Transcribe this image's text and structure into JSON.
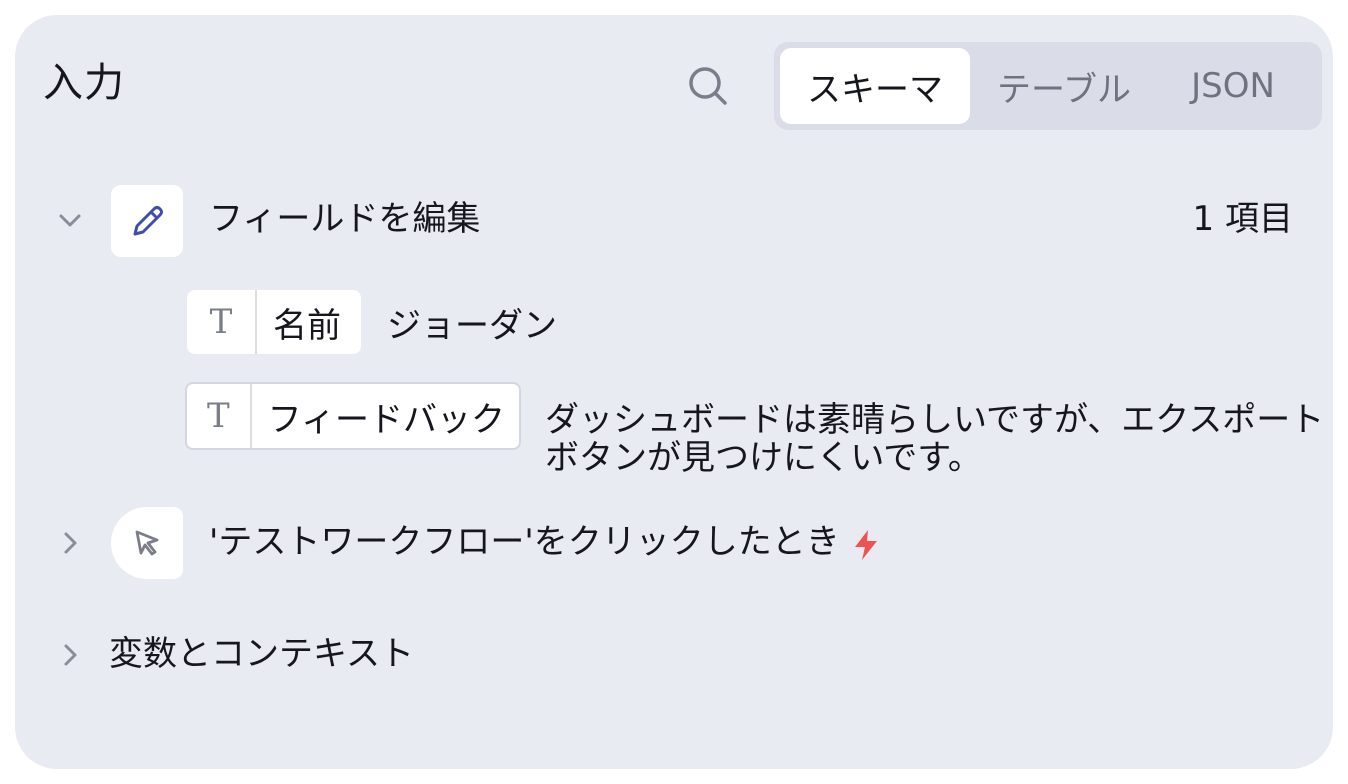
{
  "header": {
    "title": "入力",
    "search_icon": "search-icon",
    "tabs": [
      {
        "label": "スキーマ",
        "active": true
      },
      {
        "label": "テーブル",
        "active": false
      },
      {
        "label": "JSON",
        "active": false
      }
    ]
  },
  "form_section": {
    "expanded": true,
    "icon": "pencil-icon",
    "label": "フィールドを編集",
    "count": "1 項目",
    "fields": [
      {
        "type_icon": "T",
        "name": "名前",
        "value": "ジョーダン"
      },
      {
        "type_icon": "T",
        "name": "フィードバック",
        "value_line1": "ダッシュボードは素晴らしいですが、エクスポート",
        "value_line2": "ボタンが見つけにくいです。"
      }
    ]
  },
  "trigger_section": {
    "expanded": false,
    "icon": "cursor-click-icon",
    "label": "'テストワークフロー'をクリックしたとき",
    "badge_icon": "lightning-icon",
    "badge_color": "#ef5350"
  },
  "variables_section": {
    "expanded": false,
    "label": "変数とコンテキスト"
  },
  "colors": {
    "panel_bg": "#e9ebf3",
    "segmented_bg": "#dadce7",
    "accent_pencil": "#3f4db0"
  }
}
